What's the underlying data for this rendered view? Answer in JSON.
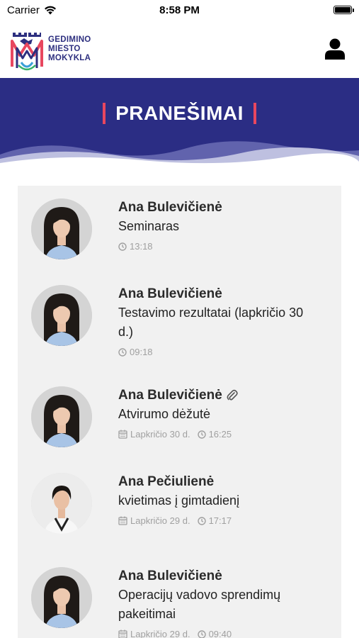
{
  "status_bar": {
    "carrier": "Carrier",
    "time": "8:58 PM"
  },
  "header": {
    "logo_lines": [
      "GEDIMINO",
      "MIESTO",
      "MOKYKLA"
    ]
  },
  "banner": {
    "title": "PRANEŠIMAI"
  },
  "messages": [
    {
      "sender": "Ana Bulevičienė",
      "subject_lines": [
        "Seminaras"
      ],
      "date": "",
      "time": "13:18",
      "attachment": false,
      "avatar": "hair-long"
    },
    {
      "sender": "Ana Bulevičienė",
      "subject_lines": [
        "Testavimo rezultatai (lapkričio 30",
        "d.)"
      ],
      "date": "",
      "time": "09:18",
      "attachment": false,
      "avatar": "hair-long"
    },
    {
      "sender": "Ana Bulevičienė",
      "subject_lines": [
        "Atvirumo dėžutė"
      ],
      "date": "Lapkričio 30 d.",
      "time": "16:25",
      "attachment": true,
      "avatar": "hair-long"
    },
    {
      "sender": "Ana Pečiulienė",
      "subject_lines": [
        "kvietimas į gimtadienį"
      ],
      "date": "Lapkričio 29 d.",
      "time": "17:17",
      "attachment": false,
      "avatar": "hair-short"
    },
    {
      "sender": "Ana Bulevičienė",
      "subject_lines": [
        "Operacijų vadovo sprendimų",
        "pakeitimai"
      ],
      "date": "Lapkričio 29 d.",
      "time": "09:40",
      "attachment": false,
      "avatar": "hair-long"
    }
  ],
  "colors": {
    "banner": "#2b2d84",
    "accent_bar": "#e8475f",
    "list_bg": "#f1f1f1",
    "meta_text": "#a0a0a0"
  }
}
